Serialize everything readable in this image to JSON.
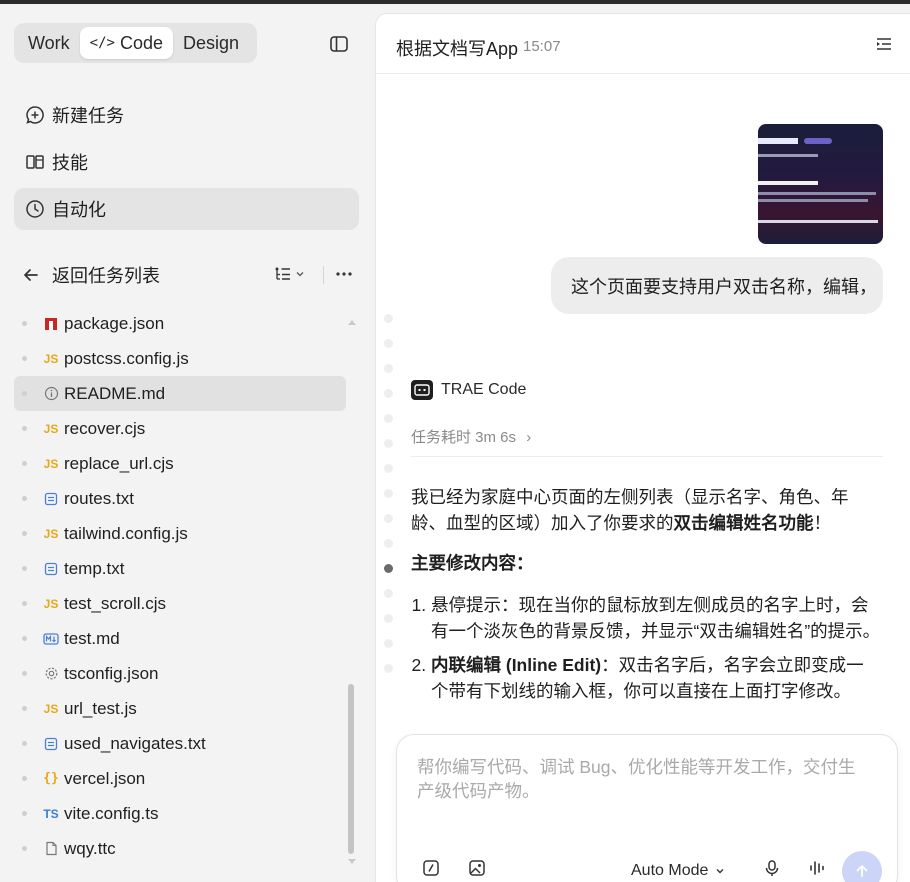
{
  "mode_tabs": [
    {
      "label": "Work"
    },
    {
      "label": "Code",
      "icon": "code-icon",
      "active": true
    },
    {
      "label": "Design"
    }
  ],
  "nav": {
    "new_task": "新建任务",
    "skills": "技能",
    "automation": "自动化"
  },
  "file_panel": {
    "back_label": "返回任务列表",
    "files": [
      {
        "name": "package.json",
        "icon": "npm-icon"
      },
      {
        "name": "postcss.config.js",
        "icon": "JS"
      },
      {
        "name": "README.md",
        "icon": "info-icon",
        "active": true
      },
      {
        "name": "recover.cjs",
        "icon": "JS"
      },
      {
        "name": "replace_url.cjs",
        "icon": "JS"
      },
      {
        "name": "routes.txt",
        "icon": "text-file-icon"
      },
      {
        "name": "tailwind.config.js",
        "icon": "JS"
      },
      {
        "name": "temp.txt",
        "icon": "text-file-icon"
      },
      {
        "name": "test_scroll.cjs",
        "icon": "JS"
      },
      {
        "name": "test.md",
        "icon": "markdown-icon"
      },
      {
        "name": "tsconfig.json",
        "icon": "gear-icon"
      },
      {
        "name": "url_test.js",
        "icon": "JS"
      },
      {
        "name": "used_navigates.txt",
        "icon": "text-file-icon"
      },
      {
        "name": "vercel.json",
        "icon": "braces-icon"
      },
      {
        "name": "vite.config.ts",
        "icon": "TS"
      },
      {
        "name": "wqy.ttc",
        "icon": "file-icon"
      }
    ]
  },
  "chat": {
    "title": "根据文档写App",
    "time": "15:07",
    "user_message": "这个页面要支持用户双击名称，编辑，",
    "agent_name": "TRAE Code",
    "duration": "任务耗时 3m 6s",
    "reply": {
      "intro": "我已经为家庭中心页面的左侧列表（显示名字、角色、年龄、血型的区域）加入了你要求的",
      "intro_bold": "双击编辑姓名功能",
      "intro_end": "！",
      "heading": "主要修改内容：",
      "items": [
        {
          "text": "悬停提示：现在当你的鼠标放到左侧成员的名字上时，会有一个淡灰色的背景反馈，并显示“双击编辑姓名”的提示。"
        },
        {
          "bold": "内联编辑 (Inline Edit)",
          "text": "：双击名字后，名字会立即变成一个带有下划线的输入框，你可以直接在上面打字修改。"
        }
      ]
    }
  },
  "composer": {
    "placeholder": "帮你编写代码、调试 Bug、优化性能等开发工作，交付生产级代码产物。",
    "mode": "Auto Mode"
  },
  "colors": {
    "accent_send": "#ccd4f7",
    "js_icon": "#e6a817",
    "ts_icon": "#3b7dd8",
    "npm_icon": "#c62828"
  }
}
